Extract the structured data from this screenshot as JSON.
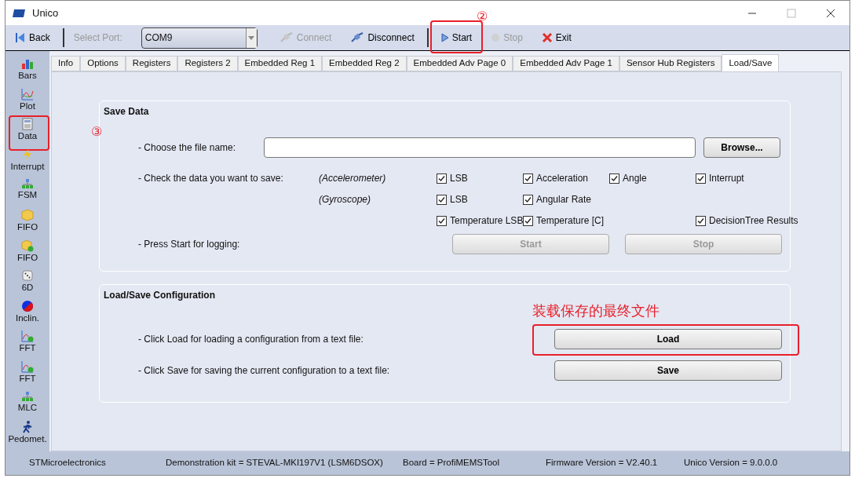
{
  "window": {
    "title": "Unico"
  },
  "toolbar": [
    {
      "kind": "button",
      "label": "Back",
      "disabled": false
    },
    {
      "kind": "separator"
    },
    {
      "kind": "label",
      "label": "Select Port:",
      "disabled": true
    },
    {
      "kind": "combo",
      "value": "COM9"
    },
    {
      "kind": "button",
      "label": "Connect",
      "disabled": true
    },
    {
      "kind": "button",
      "label": "Disconnect",
      "disabled": false
    },
    {
      "kind": "separator"
    },
    {
      "kind": "button",
      "label": "Start",
      "disabled": false,
      "highlighted": true,
      "marker": "②"
    },
    {
      "kind": "button",
      "label": "Stop",
      "disabled": true
    },
    {
      "kind": "button",
      "label": "Exit",
      "disabled": false
    }
  ],
  "sidebar": [
    {
      "label": "Bars"
    },
    {
      "label": "Plot"
    },
    {
      "label": "Data",
      "highlighted": true,
      "marker": "③"
    },
    {
      "label": "Interrupt"
    },
    {
      "label": "FSM"
    },
    {
      "label": "FIFO"
    },
    {
      "label": "FIFO"
    },
    {
      "label": "6D"
    },
    {
      "label": "Inclin."
    },
    {
      "label": "FFT"
    },
    {
      "label": "FFT"
    },
    {
      "label": "MLC"
    },
    {
      "label": "Pedomet."
    }
  ],
  "tabs": [
    {
      "label": "Info",
      "selected": false
    },
    {
      "label": "Options",
      "selected": false
    },
    {
      "label": "Registers",
      "selected": false
    },
    {
      "label": "Registers 2",
      "selected": false
    },
    {
      "label": "Embedded Reg 1",
      "selected": false
    },
    {
      "label": "Embedded Reg 2",
      "selected": false
    },
    {
      "label": "Embedded Adv Page 0",
      "selected": false
    },
    {
      "label": "Embedded Adv Page 1",
      "selected": false
    },
    {
      "label": "Sensor Hub Registers",
      "selected": false
    },
    {
      "label": "Load/Save",
      "selected": true
    }
  ],
  "save_data": {
    "title": "Save Data",
    "file_label": "- Choose the file name:",
    "browse": "Browse...",
    "check_label": "- Check the data you want to save:",
    "check_rows": [
      {
        "sensor": "(Accelerometer)",
        "column_1": {
          "label": "LSB",
          "checked": true
        },
        "column_2": {
          "label": "Acceleration",
          "checked": true
        },
        "column_3": {
          "label": "Angle",
          "checked": true
        },
        "column_4": {
          "label": "Interrupt",
          "checked": true
        }
      },
      {
        "sensor": "(Gyroscope)",
        "column_1": {
          "label": "LSB",
          "checked": true
        },
        "column_2": {
          "label": "Angular Rate",
          "checked": true
        }
      },
      {
        "column_1": {
          "label": "Temperature LSB",
          "checked": true
        },
        "column_2": {
          "label": "Temperature [C]",
          "checked": true
        },
        "column_4": {
          "label": "DecisionTree Results",
          "checked": true
        }
      }
    ],
    "logging_label": "- Press Start for logging:",
    "buttons": [
      {
        "label": "Start",
        "disabled": true
      },
      {
        "label": "Stop",
        "disabled": true
      }
    ]
  },
  "config": {
    "title": "Load/Save Configuration",
    "note": "装载保存的最终文件",
    "rows": [
      {
        "label": "- Click Load for loading a configuration from a text file:",
        "button": "Load",
        "highlighted": true
      },
      {
        "label": "- Click Save for saving the current configuration to a text file:",
        "button": "Save"
      }
    ]
  },
  "status_bar": [
    "STMicroelectronics",
    "Demonstration kit = STEVAL-MKI197V1 (LSM6DSOX)",
    "Board = ProfiMEMSTool",
    "Firmware Version = V2.40.1",
    "Unico Version = 9.0.0.0"
  ]
}
